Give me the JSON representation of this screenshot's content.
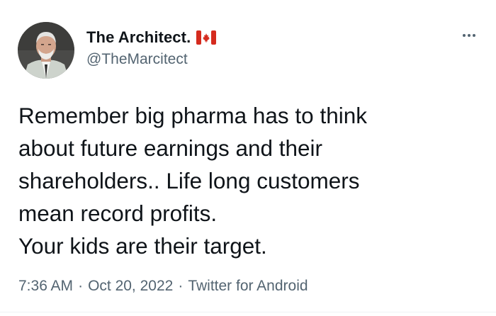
{
  "author": {
    "display_name": "The Architect.",
    "flag_icon": "canada-flag-icon",
    "handle": "@TheMarcitect"
  },
  "tweet": {
    "text": "Remember big pharma has to think\nabout future earnings and their\nshareholders.. Life long customers\nmean record profits.\nYour kids are their target.",
    "time": "7:36 AM",
    "date": "Oct 20, 2022",
    "source": "Twitter for Android",
    "separator": "·"
  },
  "icons": {
    "more": "more-options-icon"
  },
  "colors": {
    "text_primary": "#0f1419",
    "text_secondary": "#536471",
    "flag_red": "#d52b1e"
  }
}
